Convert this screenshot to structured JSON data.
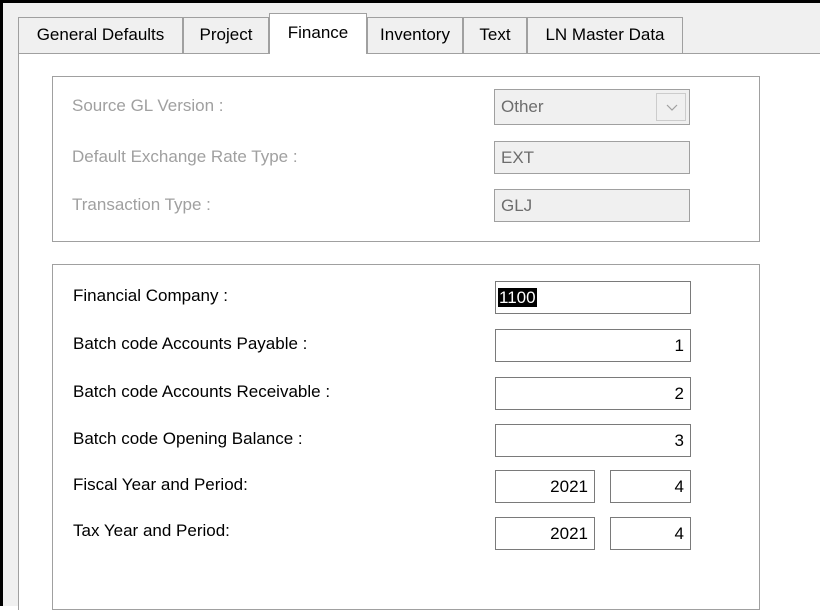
{
  "tabs": [
    {
      "label": "General Defaults"
    },
    {
      "label": "Project"
    },
    {
      "label": "Finance"
    },
    {
      "label": "Inventory"
    },
    {
      "label": "Text"
    },
    {
      "label": "LN Master Data"
    }
  ],
  "active_tab": "Finance",
  "gl_group": {
    "source_gl_version": {
      "label": "Source GL Version :",
      "value": "Other"
    },
    "default_exchange_rate_type": {
      "label": "Default Exchange Rate Type :",
      "value": "EXT"
    },
    "transaction_type": {
      "label": "Transaction Type :",
      "value": "GLJ"
    }
  },
  "company_group": {
    "financial_company": {
      "label": "Financial Company :",
      "value": "1100"
    },
    "batch_ap": {
      "label": "Batch code Accounts Payable :",
      "value": "1"
    },
    "batch_ar": {
      "label": "Batch code Accounts Receivable :",
      "value": "2"
    },
    "batch_ob": {
      "label": "Batch code Opening Balance :",
      "value": "3"
    },
    "fiscal": {
      "label": "Fiscal Year and Period:",
      "year": "2021",
      "period": "4"
    },
    "tax": {
      "label": "Tax Year and Period:",
      "year": "2021",
      "period": "4"
    }
  },
  "colors": {
    "disabled_text": "#a0a0a0",
    "selection": "#000000",
    "panel": "#ffffff",
    "chrome": "#f0f0f0"
  },
  "icons": {
    "combo_arrow": "chevron-down-icon"
  }
}
